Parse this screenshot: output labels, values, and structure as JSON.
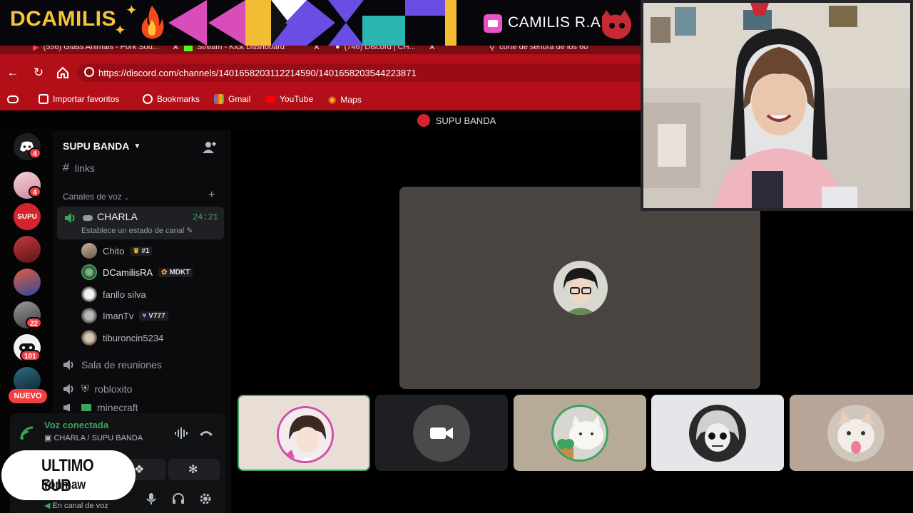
{
  "overlay": {
    "brand": "DCAMILIS",
    "channel_name": "CAMILIS R.A",
    "last_sub_title": "ULTIMO SUB",
    "last_sub_name": "Ironmaw"
  },
  "browser": {
    "tabs": [
      {
        "label": "(556) Glass Animals - Pork Sou...",
        "icon": "youtube-icon"
      },
      {
        "label": "Stream - Kick Dashboard",
        "icon": "kick-icon"
      },
      {
        "label": "(746) Discord | CH...",
        "icon": "discord-icon"
      },
      {
        "label": "corte de señora de los 60",
        "icon": "search-icon"
      }
    ],
    "url": "https://discord.com/channels/1401658203112214590/1401658203544223871",
    "bookmarks": [
      "Importar favoritos",
      "Bookmarks",
      "Gmail",
      "YouTube",
      "Maps"
    ]
  },
  "discord": {
    "window_title": "SUPU BANDA",
    "server_name": "SUPU BANDA",
    "partial_channel": "links",
    "voice_category": "Canales de voz",
    "active_channel": {
      "name": "CHARLA",
      "time": "24:21",
      "status": "Establece un estado de canal"
    },
    "members": [
      {
        "name": "Chito",
        "tag": "#1",
        "tag_icon": "crown-icon"
      },
      {
        "name": "DCamilisRA",
        "tag": "MDKT",
        "tag_icon": "cat-icon"
      },
      {
        "name": "fanllo silva",
        "tag": "",
        "tag_icon": ""
      },
      {
        "name": "ImanTv",
        "tag": "V777",
        "tag_icon": "heart-icon"
      },
      {
        "name": "tiburoncin5234",
        "tag": "",
        "tag_icon": ""
      }
    ],
    "voice_channels": [
      "Sala de reuniones",
      "robloxito",
      "minecraft"
    ],
    "server_badges": [
      "4",
      "4",
      "22",
      "101"
    ],
    "new_pill": "NUEVO",
    "voice_panel": {
      "title": "Voz conectada",
      "subtitle": "CHARLA / SUPU BANDA"
    },
    "user_status": "En canal de voz",
    "colors": {
      "accent_green": "#3ba55d",
      "browser_red": "#b20f19",
      "badge_red": "#f23f43"
    }
  }
}
